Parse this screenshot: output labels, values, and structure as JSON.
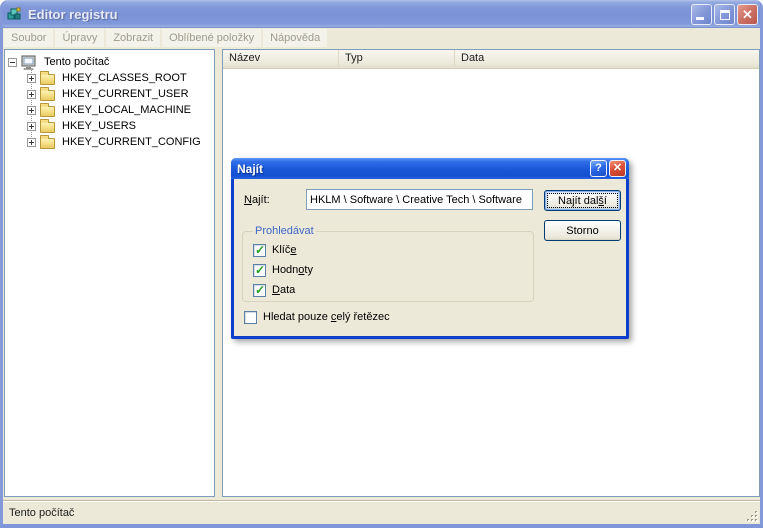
{
  "window": {
    "title": "Editor registru"
  },
  "menubar": {
    "items": [
      "Soubor",
      "Úpravy",
      "Zobrazit",
      "Oblíbené položky",
      "Nápověda"
    ]
  },
  "tree": {
    "root": "Tento počítač",
    "items": [
      "HKEY_CLASSES_ROOT",
      "HKEY_CURRENT_USER",
      "HKEY_LOCAL_MACHINE",
      "HKEY_USERS",
      "HKEY_CURRENT_CONFIG"
    ]
  },
  "list": {
    "columns": [
      "Název",
      "Typ",
      "Data"
    ]
  },
  "statusbar": {
    "text": "Tento počítač"
  },
  "dialog": {
    "title": "Najít",
    "find_label": {
      "pre": "",
      "mn": "N",
      "post": "ajít:"
    },
    "find_value": "HKLM \\ Software \\ Creative Tech \\ Software",
    "find_next": {
      "pre": "Najít dal",
      "mn": "š",
      "post": "í"
    },
    "cancel": "Storno",
    "group_title": "Prohledávat",
    "checks": [
      {
        "pre": "Klíč",
        "mn": "e",
        "post": "",
        "checked": true
      },
      {
        "pre": "Hodn",
        "mn": "o",
        "post": "ty",
        "checked": true
      },
      {
        "pre": "",
        "mn": "D",
        "post": "ata",
        "checked": true
      }
    ],
    "whole": {
      "pre": "Hledat pouze ",
      "mn": "c",
      "post": "elý řetězec",
      "checked": false
    }
  },
  "icons": {
    "help": "?",
    "close": "✕",
    "check": "✓"
  },
  "colors": {
    "dialog_title_blue": "#1a57d8",
    "inactive_title_blue": "#7e96d8",
    "dialog_border_blue": "#0d3fcd",
    "check_green": "#21a121",
    "groupbox_label_blue": "#4067c8",
    "chrome_beige": "#ece9d8",
    "panel_border": "#7f9db9"
  }
}
